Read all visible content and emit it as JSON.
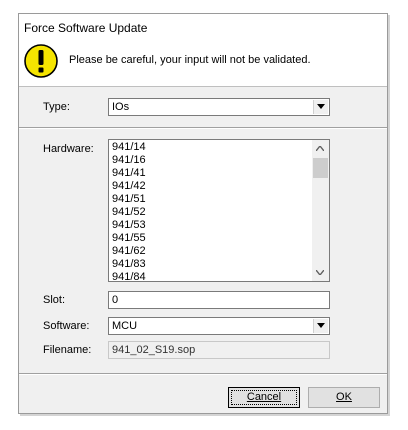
{
  "window": {
    "title": "Force Software Update"
  },
  "warning": {
    "text": "Please be careful, your input will not be validated.",
    "icon": "warning-icon",
    "color": "#f0e000"
  },
  "fields": {
    "type_label": "Type:",
    "type_value": "IOs",
    "hardware_label": "Hardware:",
    "hardware_items": [
      "941/14",
      "941/16",
      "941/41",
      "941/42",
      "941/51",
      "941/52",
      "941/53",
      "941/55",
      "941/62",
      "941/83",
      "941/84"
    ],
    "slot_label": "Slot:",
    "slot_value": "0",
    "software_label": "Software:",
    "software_value": "MCU",
    "filename_label": "Filename:",
    "filename_value": "941_02_S19.sop"
  },
  "buttons": {
    "cancel_label": "Cancel",
    "ok_label": "OK"
  }
}
